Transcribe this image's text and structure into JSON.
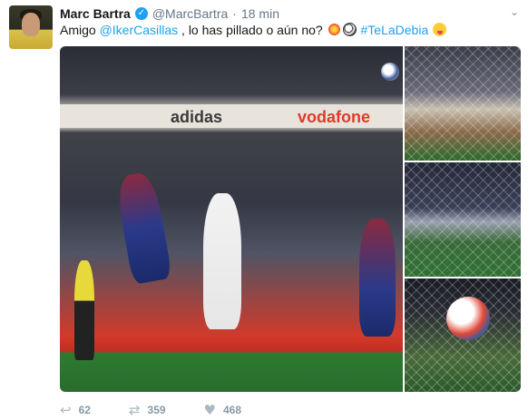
{
  "tweet": {
    "author_name": "Marc Bartra",
    "author_handle": "@MarcBartra",
    "separator": "·",
    "timestamp": "18 min",
    "text_before": "Amigo ",
    "mention": "@IkerCasillas",
    "text_after": " , lo has pillado o aún no? ",
    "hashtag": "#TeLaDebia",
    "verified_icon": "check-verified-icon",
    "more_icon": "chevron-down-icon"
  },
  "media": {
    "main_image": {
      "board_brand_1": "adidas",
      "board_brand_2": "vodafone"
    },
    "thumbnails_count": 3
  },
  "actions": {
    "reply_count": "62",
    "retweet_count": "359",
    "like_count": "468"
  },
  "colors": {
    "link": "#1da1f2",
    "muted": "#657786",
    "icon": "#aab8c2"
  }
}
